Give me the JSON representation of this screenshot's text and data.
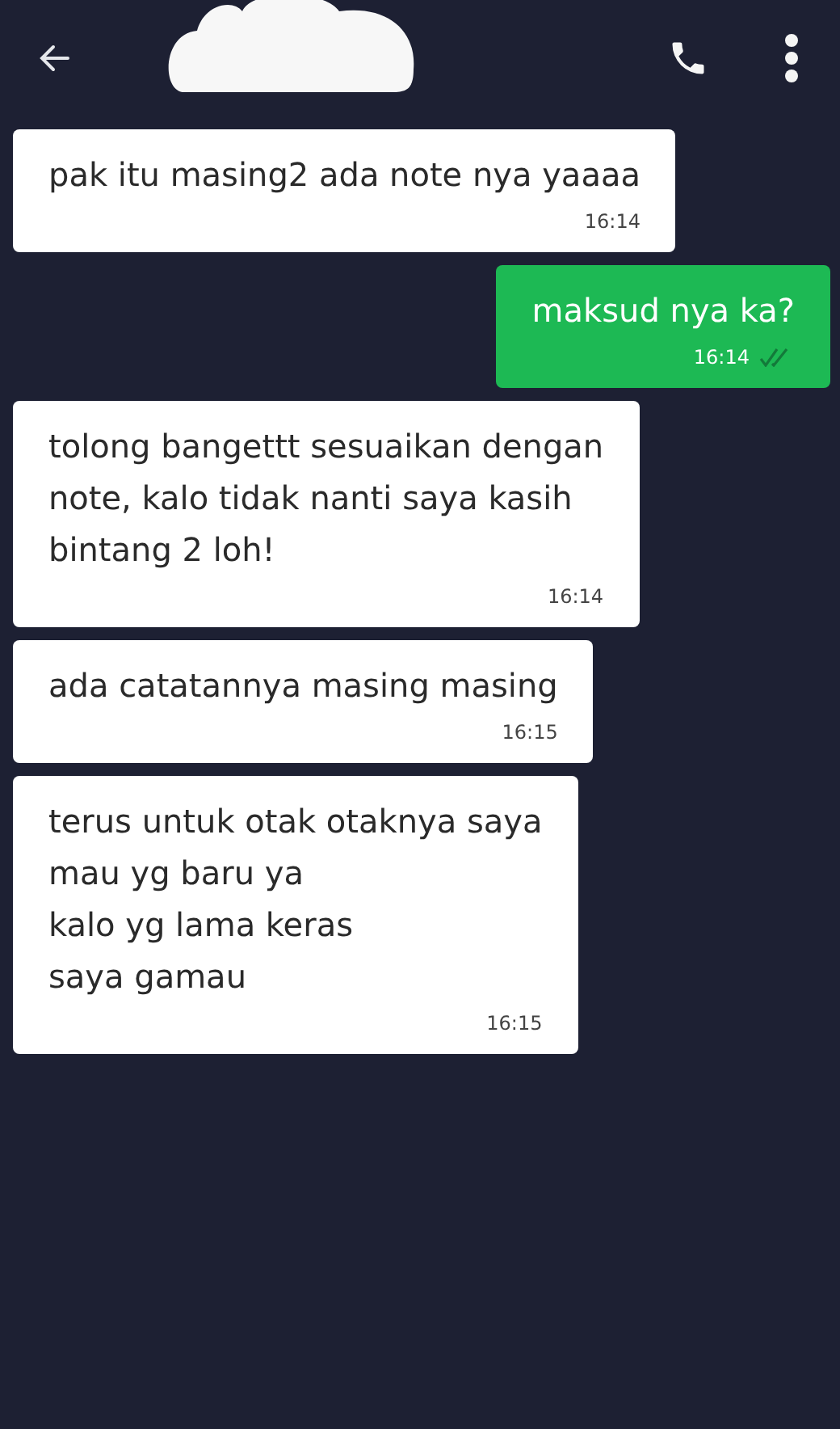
{
  "header": {
    "redacted_name": true
  },
  "messages": [
    {
      "kind": "incoming",
      "lines": [
        "pak itu masing2 ada note nya yaaaa"
      ],
      "time": "16:14"
    },
    {
      "kind": "outgoing",
      "lines": [
        "maksud nya ka?"
      ],
      "time": "16:14",
      "read": true
    },
    {
      "kind": "incoming",
      "lines": [
        "tolong bangettt sesuaikan dengan",
        "note, kalo tidak nanti saya kasih",
        "bintang 2 loh!"
      ],
      "time": "16:14"
    },
    {
      "kind": "incoming",
      "lines": [
        "ada catatannya masing masing"
      ],
      "time": "16:15"
    },
    {
      "kind": "incoming",
      "lines": [
        "terus untuk otak otaknya saya",
        "mau yg baru ya",
        "kalo yg lama keras",
        "saya gamau"
      ],
      "time": "16:15"
    }
  ]
}
